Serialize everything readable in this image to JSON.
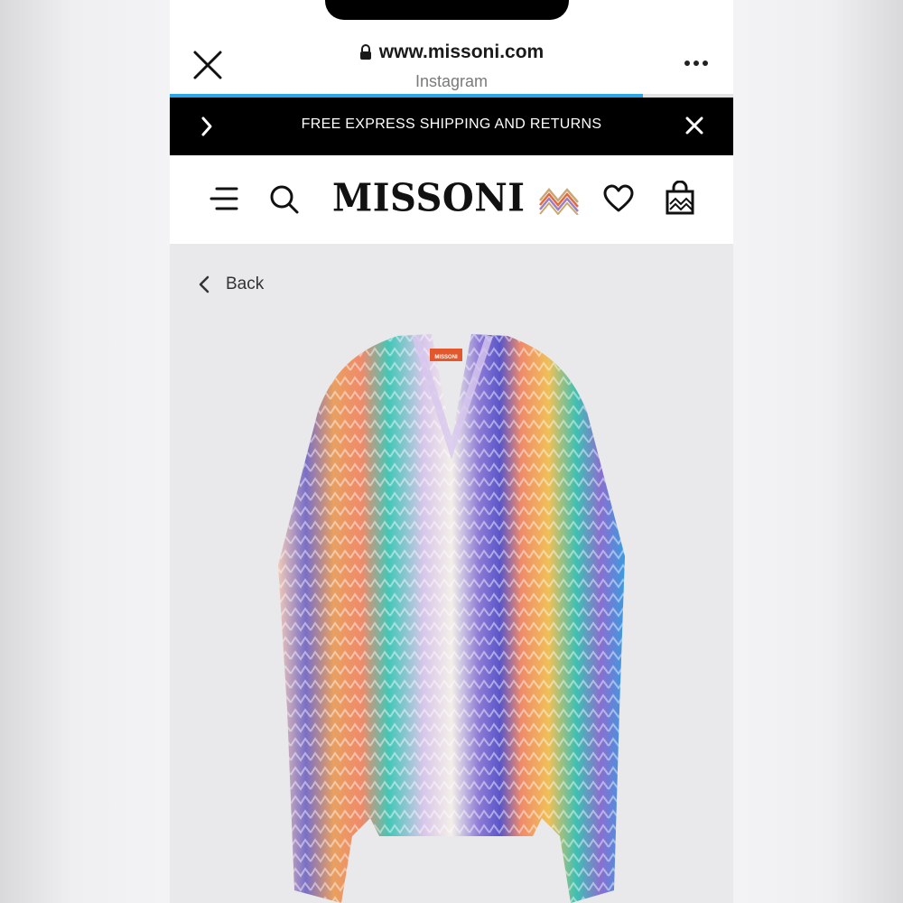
{
  "browser": {
    "url": "www.missoni.com",
    "source": "Instagram",
    "load_progress": 0.84
  },
  "promo": {
    "text": "FREE EXPRESS SHIPPING AND RETURNS"
  },
  "site": {
    "brand": "MISSONI"
  },
  "page": {
    "back_label": "Back",
    "product_label_text": "MISSONI"
  },
  "colors": {
    "accent_progress": "#2aa7e8",
    "promo_bg": "#000000",
    "content_bg": "#e9e9eb"
  },
  "icons": [
    "close-icon",
    "lock-icon",
    "more-icon",
    "chevron-right-icon",
    "close-banner-icon",
    "menu-icon",
    "search-icon",
    "zigzag-logo-icon",
    "heart-icon",
    "shopping-bag-icon",
    "chevron-left-icon"
  ]
}
